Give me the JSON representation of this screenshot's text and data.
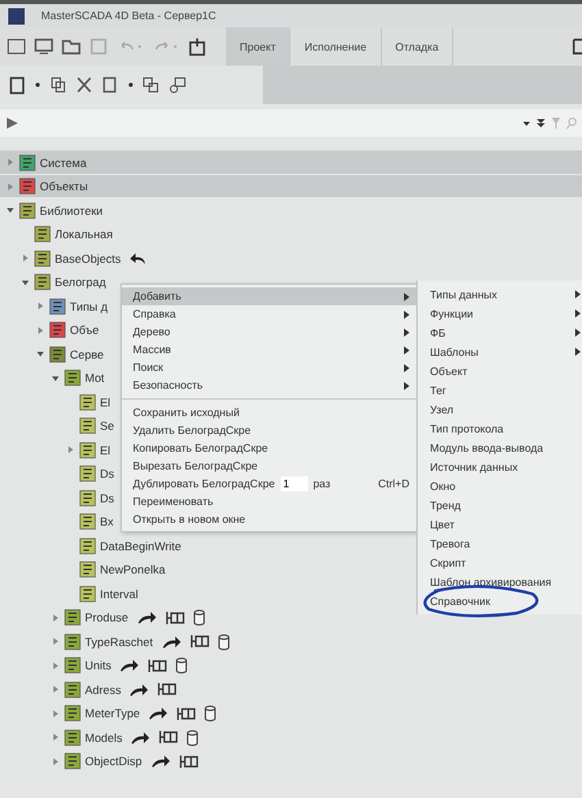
{
  "window": {
    "title": "MasterSCADA 4D Beta - Сервер1С"
  },
  "tabs": [
    {
      "label": "Проект",
      "selected": true
    },
    {
      "label": "Исполнение",
      "selected": false
    },
    {
      "label": "Отладка",
      "selected": false
    }
  ],
  "sections": [
    {
      "label": "Система",
      "kind": "system",
      "expanded": false
    },
    {
      "label": "Объекты",
      "kind": "objects",
      "expanded": false
    }
  ],
  "tree": [
    {
      "label": "Библиотеки",
      "kind": "library",
      "expanded": true,
      "children": [
        {
          "label": "Локальная",
          "kind": "library"
        },
        {
          "label": "BaseObjects",
          "kind": "library",
          "expanded": false,
          "badges": [
            {
              "kind": "undo"
            }
          ]
        },
        {
          "label": "Белоград",
          "kind": "library",
          "expanded": true,
          "children": [
            {
              "label": "Типы д",
              "kind": "types",
              "expanded": false
            },
            {
              "label": "Объе",
              "kind": "objects",
              "expanded": false
            },
            {
              "label": "Серве",
              "kind": "folder",
              "expanded": true,
              "children": [
                {
                  "label": "Mot",
                  "kind": "module",
                  "expanded": true,
                  "children": [
                    {
                      "label": "El",
                      "kind": "item"
                    },
                    {
                      "label": "Se",
                      "kind": "item"
                    },
                    {
                      "label": "El",
                      "kind": "item",
                      "expanded": false
                    },
                    {
                      "label": "Ds",
                      "kind": "item"
                    },
                    {
                      "label": "Ds",
                      "kind": "item"
                    },
                    {
                      "label": "Bx",
                      "kind": "item"
                    },
                    {
                      "label": "DataBeginWrite",
                      "kind": "item"
                    },
                    {
                      "label": "NewPonelka",
                      "kind": "item"
                    },
                    {
                      "label": "Interval",
                      "kind": "item"
                    }
                  ]
                },
                {
                  "label": "Produse",
                  "kind": "module",
                  "expanded": false,
                  "badges": [
                    {
                      "kind": "link"
                    },
                    {
                      "kind": "io"
                    },
                    {
                      "kind": "db"
                    }
                  ]
                },
                {
                  "label": "TypeRaschet",
                  "kind": "module",
                  "expanded": false,
                  "badges": [
                    {
                      "kind": "link"
                    },
                    {
                      "kind": "io"
                    },
                    {
                      "kind": "db"
                    }
                  ]
                },
                {
                  "label": "Units",
                  "kind": "module",
                  "expanded": false,
                  "badges": [
                    {
                      "kind": "link"
                    },
                    {
                      "kind": "io"
                    },
                    {
                      "kind": "db"
                    }
                  ]
                },
                {
                  "label": "Adress",
                  "kind": "module",
                  "expanded": false,
                  "badges": [
                    {
                      "kind": "link"
                    },
                    {
                      "kind": "io"
                    }
                  ]
                },
                {
                  "label": "MeterType",
                  "kind": "module",
                  "expanded": false,
                  "badges": [
                    {
                      "kind": "link"
                    },
                    {
                      "kind": "io"
                    },
                    {
                      "kind": "db"
                    }
                  ]
                },
                {
                  "label": "Models",
                  "kind": "module",
                  "expanded": false,
                  "badges": [
                    {
                      "kind": "link"
                    },
                    {
                      "kind": "io"
                    },
                    {
                      "kind": "db"
                    }
                  ]
                },
                {
                  "label": "ObjectDisp",
                  "kind": "module",
                  "expanded": false,
                  "badges": [
                    {
                      "kind": "link"
                    },
                    {
                      "kind": "io"
                    }
                  ]
                }
              ]
            }
          ]
        }
      ]
    }
  ],
  "context_menu": {
    "groups": [
      [
        {
          "label": "Добавить",
          "kind": "submenu",
          "selected": true
        },
        {
          "label": "Справка",
          "kind": "submenu",
          "selected": false
        },
        {
          "label": "Дерево",
          "kind": "submenu",
          "selected": false
        },
        {
          "label": "Массив",
          "kind": "submenu",
          "selected": false
        },
        {
          "label": "Поиск",
          "kind": "submenu",
          "selected": false
        },
        {
          "label": "Безопасность",
          "kind": "submenu",
          "selected": false
        }
      ],
      [
        {
          "label": "Сохранить исходный",
          "kind": "action",
          "selected": false
        },
        {
          "label": "Удалить БелоградСкре",
          "kind": "action",
          "selected": false
        },
        {
          "label": "Копировать БелоградСкре",
          "kind": "action",
          "selected": false
        },
        {
          "label": "Вырезать БелоградСкре",
          "kind": "action",
          "selected": false
        },
        {
          "label": "Дублировать БелоградСкре",
          "kind": "count",
          "value": "1",
          "suffix": "раз",
          "shortcut": "Ctrl+D",
          "selected": false
        },
        {
          "label": "Переименовать",
          "kind": "action",
          "selected": false
        },
        {
          "label": "Открыть в новом окне",
          "kind": "action",
          "selected": false
        }
      ]
    ]
  },
  "submenu": [
    {
      "label": "Типы данных",
      "kind": "submenu",
      "circled": false
    },
    {
      "label": "Функции",
      "kind": "submenu",
      "circled": false
    },
    {
      "label": "ФБ",
      "kind": "submenu",
      "circled": false
    },
    {
      "label": "Шаблоны",
      "kind": "submenu",
      "circled": false
    },
    {
      "label": "Объект",
      "kind": "action",
      "circled": false
    },
    {
      "label": "Тег",
      "kind": "action",
      "circled": false
    },
    {
      "label": "Узел",
      "kind": "action",
      "circled": false
    },
    {
      "label": "Тип протокола",
      "kind": "action",
      "circled": false
    },
    {
      "label": "Модуль ввода-вывода",
      "kind": "action",
      "circled": false
    },
    {
      "label": "Источник данных",
      "kind": "action",
      "circled": false
    },
    {
      "label": "Окно",
      "kind": "action",
      "circled": false
    },
    {
      "label": "Тренд",
      "kind": "action",
      "circled": false
    },
    {
      "label": "Цвет",
      "kind": "action",
      "circled": false
    },
    {
      "label": "Тревога",
      "kind": "action",
      "circled": false
    },
    {
      "label": "Скрипт",
      "kind": "action",
      "circled": false
    },
    {
      "label": "Шаблон архивирования",
      "kind": "action",
      "circled": false
    },
    {
      "label": "Справочник",
      "kind": "action",
      "circled": true
    }
  ]
}
